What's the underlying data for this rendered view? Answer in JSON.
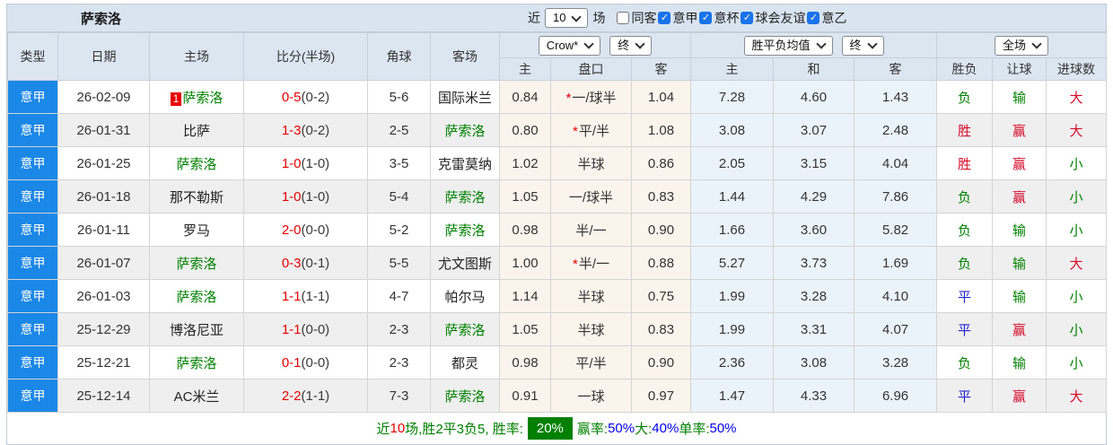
{
  "topbar": {
    "title": "萨索洛",
    "recent_prefix": "近",
    "recent_value": "10",
    "recent_suffix": "场",
    "filters": [
      {
        "label": "同客",
        "checked": false
      },
      {
        "label": "意甲",
        "checked": true
      },
      {
        "label": "意杯",
        "checked": true
      },
      {
        "label": "球会友谊",
        "checked": true
      },
      {
        "label": "意乙",
        "checked": true
      }
    ]
  },
  "controls": {
    "company": "Crow*",
    "company_time": "终",
    "avg": "胜平负均值",
    "avg_time": "终",
    "scope": "全场"
  },
  "header": {
    "main": [
      "类型",
      "日期",
      "主场",
      "比分(半场)",
      "角球",
      "客场"
    ],
    "odds_sub": [
      "主",
      "盘口",
      "客"
    ],
    "avg_sub": [
      "主",
      "和",
      "客"
    ],
    "result_sub": [
      "胜负",
      "让球",
      "进球数"
    ]
  },
  "icons": {
    "check": "✓",
    "star": "*"
  },
  "result_colors": {
    "胜": "red",
    "平": "blue",
    "负": "green",
    "赢": "red",
    "输": "green",
    "大": "red",
    "小": "green"
  },
  "rows": [
    {
      "league": "意甲",
      "date": "26-02-09",
      "home": "萨索洛",
      "home_self": true,
      "home_badge": "1",
      "score_ft": "0-5",
      "score_ht": "(0-2)",
      "corner": "5-6",
      "away": "国际米兰",
      "away_self": false,
      "odds_home": "0.84",
      "handicap": "一/球半",
      "handicap_star": true,
      "odds_away": "1.04",
      "avg_win": "7.28",
      "avg_draw": "4.60",
      "avg_lose": "1.43",
      "res_wdl": "负",
      "res_handicap": "输",
      "res_goals": "大"
    },
    {
      "league": "意甲",
      "date": "26-01-31",
      "home": "比萨",
      "home_self": false,
      "home_badge": "",
      "score_ft": "1-3",
      "score_ht": "(0-2)",
      "corner": "2-5",
      "away": "萨索洛",
      "away_self": true,
      "odds_home": "0.80",
      "handicap": "平/半",
      "handicap_star": true,
      "odds_away": "1.08",
      "avg_win": "3.08",
      "avg_draw": "3.07",
      "avg_lose": "2.48",
      "res_wdl": "胜",
      "res_handicap": "赢",
      "res_goals": "大"
    },
    {
      "league": "意甲",
      "date": "26-01-25",
      "home": "萨索洛",
      "home_self": true,
      "home_badge": "",
      "score_ft": "1-0",
      "score_ht": "(1-0)",
      "corner": "3-5",
      "away": "克雷莫纳",
      "away_self": false,
      "odds_home": "1.02",
      "handicap": "半球",
      "handicap_star": false,
      "odds_away": "0.86",
      "avg_win": "2.05",
      "avg_draw": "3.15",
      "avg_lose": "4.04",
      "res_wdl": "胜",
      "res_handicap": "赢",
      "res_goals": "小"
    },
    {
      "league": "意甲",
      "date": "26-01-18",
      "home": "那不勒斯",
      "home_self": false,
      "home_badge": "",
      "score_ft": "1-0",
      "score_ht": "(1-0)",
      "corner": "5-4",
      "away": "萨索洛",
      "away_self": true,
      "odds_home": "1.05",
      "handicap": "一/球半",
      "handicap_star": false,
      "odds_away": "0.83",
      "avg_win": "1.44",
      "avg_draw": "4.29",
      "avg_lose": "7.86",
      "res_wdl": "负",
      "res_handicap": "赢",
      "res_goals": "小"
    },
    {
      "league": "意甲",
      "date": "26-01-11",
      "home": "罗马",
      "home_self": false,
      "home_badge": "",
      "score_ft": "2-0",
      "score_ht": "(0-0)",
      "corner": "5-2",
      "away": "萨索洛",
      "away_self": true,
      "odds_home": "0.98",
      "handicap": "半/一",
      "handicap_star": false,
      "odds_away": "0.90",
      "avg_win": "1.66",
      "avg_draw": "3.60",
      "avg_lose": "5.82",
      "res_wdl": "负",
      "res_handicap": "输",
      "res_goals": "小"
    },
    {
      "league": "意甲",
      "date": "26-01-07",
      "home": "萨索洛",
      "home_self": true,
      "home_badge": "",
      "score_ft": "0-3",
      "score_ht": "(0-1)",
      "corner": "5-5",
      "away": "尤文图斯",
      "away_self": false,
      "odds_home": "1.00",
      "handicap": "半/一",
      "handicap_star": true,
      "odds_away": "0.88",
      "avg_win": "5.27",
      "avg_draw": "3.73",
      "avg_lose": "1.69",
      "res_wdl": "负",
      "res_handicap": "输",
      "res_goals": "大"
    },
    {
      "league": "意甲",
      "date": "26-01-03",
      "home": "萨索洛",
      "home_self": true,
      "home_badge": "",
      "score_ft": "1-1",
      "score_ht": "(1-1)",
      "corner": "4-7",
      "away": "帕尔马",
      "away_self": false,
      "odds_home": "1.14",
      "handicap": "半球",
      "handicap_star": false,
      "odds_away": "0.75",
      "avg_win": "1.99",
      "avg_draw": "3.28",
      "avg_lose": "4.10",
      "res_wdl": "平",
      "res_handicap": "输",
      "res_goals": "小"
    },
    {
      "league": "意甲",
      "date": "25-12-29",
      "home": "博洛尼亚",
      "home_self": false,
      "home_badge": "",
      "score_ft": "1-1",
      "score_ht": "(0-0)",
      "corner": "2-3",
      "away": "萨索洛",
      "away_self": true,
      "odds_home": "1.05",
      "handicap": "半球",
      "handicap_star": false,
      "odds_away": "0.83",
      "avg_win": "1.99",
      "avg_draw": "3.31",
      "avg_lose": "4.07",
      "res_wdl": "平",
      "res_handicap": "赢",
      "res_goals": "小"
    },
    {
      "league": "意甲",
      "date": "25-12-21",
      "home": "萨索洛",
      "home_self": true,
      "home_badge": "",
      "score_ft": "0-1",
      "score_ht": "(0-0)",
      "corner": "2-3",
      "away": "都灵",
      "away_self": false,
      "odds_home": "0.98",
      "handicap": "平/半",
      "handicap_star": false,
      "odds_away": "0.90",
      "avg_win": "2.36",
      "avg_draw": "3.08",
      "avg_lose": "3.28",
      "res_wdl": "负",
      "res_handicap": "输",
      "res_goals": "小"
    },
    {
      "league": "意甲",
      "date": "25-12-14",
      "home": "AC米兰",
      "home_self": false,
      "home_badge": "",
      "score_ft": "2-2",
      "score_ht": "(1-1)",
      "corner": "7-3",
      "away": "萨索洛",
      "away_self": true,
      "odds_home": "0.91",
      "handicap": "一球",
      "handicap_star": false,
      "odds_away": "0.97",
      "avg_win": "1.47",
      "avg_draw": "4.33",
      "avg_lose": "6.96",
      "res_wdl": "平",
      "res_handicap": "赢",
      "res_goals": "大"
    }
  ],
  "footer": {
    "parts": [
      {
        "text": "近",
        "color": "green"
      },
      {
        "text": "10",
        "color": "red"
      },
      {
        "text": "场,胜2平3负5, 胜率:",
        "color": "green"
      },
      {
        "text": "20%",
        "style": "badge"
      },
      {
        "text": "赢率:",
        "color": "green"
      },
      {
        "text": "50%",
        "color": "blue"
      },
      {
        "text": " 大:",
        "color": "green"
      },
      {
        "text": "40%",
        "color": "blue"
      },
      {
        "text": " 单率:",
        "color": "green"
      },
      {
        "text": "50%",
        "color": "blue"
      }
    ]
  }
}
